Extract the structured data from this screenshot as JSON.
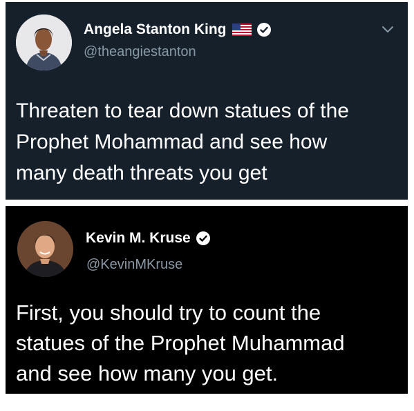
{
  "tweets": [
    {
      "name": "Angela Stanton King",
      "handle": "@theangiestanton",
      "text": "Threaten to tear down statues of the\nProphet Mohammad and see how\nmany death threats you get",
      "badges": [
        "us-flag-icon",
        "verified-badge-icon"
      ],
      "colors": {
        "background": "#15202b",
        "handle": "#8899a6"
      }
    },
    {
      "name": "Kevin M. Kruse",
      "handle": "@KevinMKruse",
      "text": "First, you should try to count the\nstatues of the Prophet Muhammad\nand see how many you get.",
      "badges": [
        "verified-badge-icon"
      ],
      "colors": {
        "background": "#000000",
        "handle": "#8b98a5"
      }
    }
  ]
}
